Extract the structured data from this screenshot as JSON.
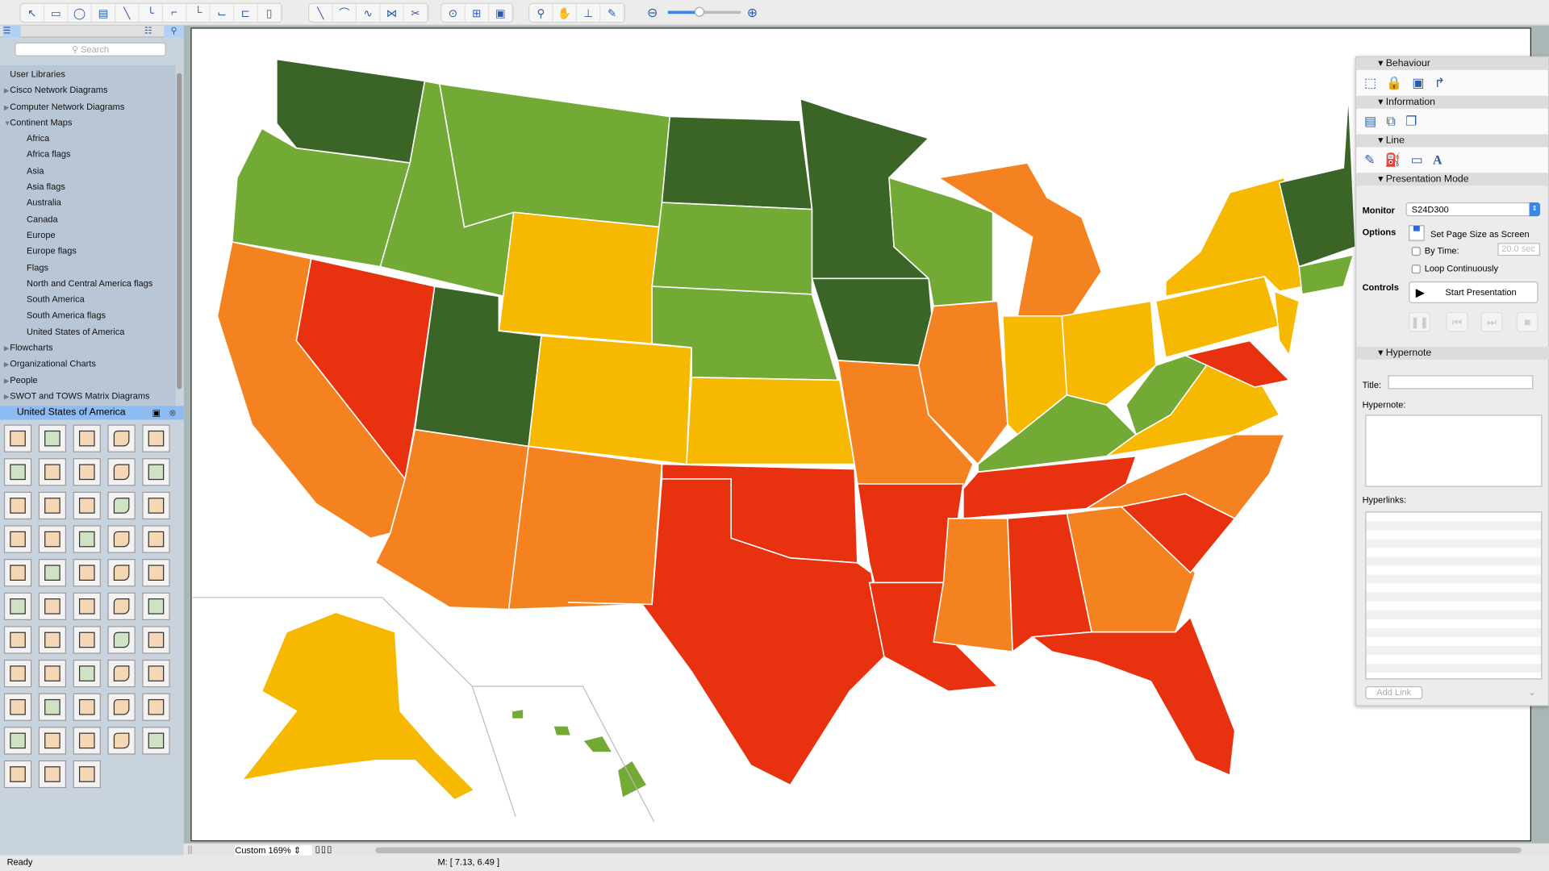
{
  "toolbar": {
    "groups": [
      [
        "pointer",
        "rectangle",
        "ellipse",
        "text-box",
        "connector-direct",
        "connector-arc",
        "connector-segmented",
        "connector-orthogonal",
        "connector-smart",
        "connector-round",
        "insert-container"
      ],
      [
        "line",
        "arc",
        "bezier",
        "polyline",
        "scissors"
      ],
      [
        "chain",
        "tree",
        "round-rect"
      ],
      [
        "zoom",
        "pan",
        "stamp",
        "eyedropper"
      ]
    ],
    "zoom_out": "zoom-out",
    "zoom_in": "zoom-in",
    "zoom_level": 0.45
  },
  "sidebar": {
    "search_placeholder": "Search",
    "tree": [
      {
        "label": "User Libraries",
        "type": "none"
      },
      {
        "label": "Cisco Network Diagrams",
        "type": "collapsed"
      },
      {
        "label": "Computer Network Diagrams",
        "type": "collapsed"
      },
      {
        "label": "Continent Maps",
        "type": "expanded"
      },
      {
        "label": "Africa",
        "type": "sub"
      },
      {
        "label": "Africa flags",
        "type": "sub"
      },
      {
        "label": "Asia",
        "type": "sub"
      },
      {
        "label": "Asia flags",
        "type": "sub"
      },
      {
        "label": "Australia",
        "type": "sub"
      },
      {
        "label": "Canada",
        "type": "sub"
      },
      {
        "label": "Europe",
        "type": "sub"
      },
      {
        "label": "Europe flags",
        "type": "sub"
      },
      {
        "label": "Flags",
        "type": "sub"
      },
      {
        "label": "North and Central America flags",
        "type": "sub"
      },
      {
        "label": "South America",
        "type": "sub"
      },
      {
        "label": "South America flags",
        "type": "sub"
      },
      {
        "label": "United States of America",
        "type": "sub"
      },
      {
        "label": "Flowcharts",
        "type": "collapsed"
      },
      {
        "label": "Organizational Charts",
        "type": "collapsed"
      },
      {
        "label": "People",
        "type": "collapsed"
      },
      {
        "label": "SWOT and TOWS Matrix Diagrams",
        "type": "collapsed"
      }
    ],
    "library_title": "United States of America"
  },
  "map": {
    "colors": {
      "dark_green": "#3b6427",
      "green": "#72aa35",
      "yellow": "#f7b800",
      "orange": "#f58220",
      "red": "#e8310f"
    }
  },
  "panel": {
    "behaviour": "Behaviour",
    "information": "Information",
    "line": "Line",
    "presentation": "Presentation Mode",
    "monitor_label": "Monitor",
    "monitor_value": "S24D300",
    "options_label": "Options",
    "set_page_size": "Set Page Size as Screen",
    "by_time": "By Time:",
    "by_time_value": "20.0 sec",
    "loop": "Loop Continuously",
    "controls_label": "Controls",
    "start": "Start Presentation",
    "hypernote": "Hypernote",
    "title_label": "Title:",
    "hypernote_label": "Hypernote:",
    "hyperlinks_label": "Hyperlinks:",
    "add_link": "Add Link"
  },
  "bottom": {
    "zoom": "Custom 169%"
  },
  "status": {
    "text": "Ready",
    "coords": "M: [ 7.13, 6.49 ]"
  }
}
